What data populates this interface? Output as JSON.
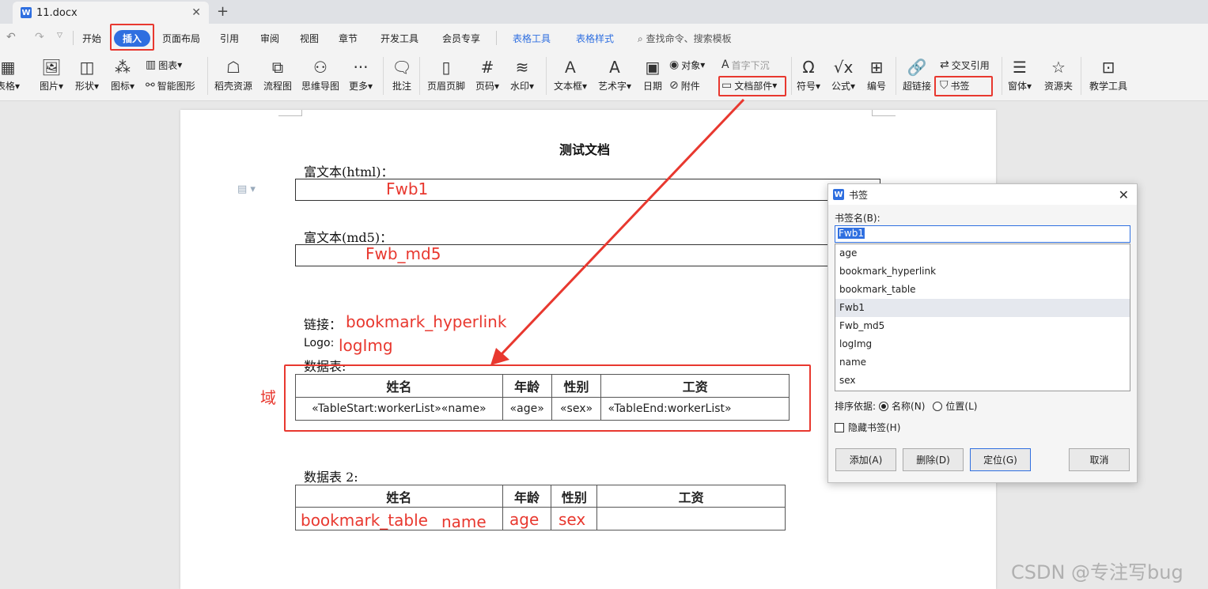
{
  "tab": {
    "icon": "W",
    "title": "11.docx",
    "close": "✕",
    "new": "+"
  },
  "menu": {
    "items": [
      "开始",
      "插入",
      "页面布局",
      "引用",
      "审阅",
      "视图",
      "章节",
      "开发工具",
      "会员专享"
    ],
    "table_tools": "表格工具",
    "table_style": "表格样式",
    "search": "查找命令、搜索模板"
  },
  "ribbon": {
    "table": "表格",
    "image": "图片",
    "shape": "形状",
    "icon": "图标",
    "chart": "图表",
    "smart_shape": "智能图形",
    "dao_ke": "稻壳资源",
    "flowchart": "流程图",
    "mindmap": "思维导图",
    "more": "更多",
    "comment": "批注",
    "header_footer": "页眉页脚",
    "page_number": "页码",
    "watermark": "水印",
    "textbox": "文本框",
    "wordart": "艺术字",
    "date": "日期",
    "object": "对象",
    "attachment": "附件",
    "drop_cap": "首字下沉",
    "doc_parts": "文档部件",
    "symbol": "符号",
    "formula": "公式",
    "numbering": "编号",
    "hyperlink": "超链接",
    "cross_ref": "交叉引用",
    "bookmark": "书签",
    "form": "窗体",
    "resource": "资源夹",
    "teaching": "教学工具"
  },
  "doc": {
    "title": "测试文档",
    "rich_html_label": "富文本(html)：",
    "fwb1": "Fwb1",
    "rich_md5_label": "富文本(md5)：",
    "fwb_md5": "Fwb_md5",
    "link_label": "链接：",
    "link_bookmark": "bookmark_hyperlink",
    "logo_label": "Logo:",
    "logo_bookmark": "logImg",
    "table_label": "数据表:",
    "field_note": "域",
    "table1_headers": [
      "姓名",
      "年龄",
      "性别",
      "工资"
    ],
    "table1_row": [
      "«TableStart:workerList»«name»",
      "«age»",
      "«sex»",
      "«TableEnd:workerList»"
    ],
    "table2_label": "数据表 2:",
    "table2_headers": [
      "姓名",
      "年龄",
      "性别",
      "工资"
    ],
    "t2_bookmark_table": "bookmark_table",
    "t2_name": "name",
    "t2_age": "age",
    "t2_sex": "sex"
  },
  "dialog": {
    "icon": "W",
    "title": "书签",
    "name_label": "书签名(B):",
    "input_value": "Fwb1",
    "items": [
      "age",
      "bookmark_hyperlink",
      "bookmark_table",
      "Fwb1",
      "Fwb_md5",
      "logImg",
      "name",
      "sex"
    ],
    "selected_index": 3,
    "sort_label": "排序依据:",
    "sort_name": "名称(N)",
    "sort_position": "位置(L)",
    "hidden_label": "隐藏书签(H)",
    "btn_add": "添加(A)",
    "btn_delete": "删除(D)",
    "btn_locate": "定位(G)",
    "btn_cancel": "取消"
  },
  "watermark": "CSDN @专注写bug",
  "colors": {
    "accent": "#2f6fe0",
    "annotation": "#e8382f"
  }
}
